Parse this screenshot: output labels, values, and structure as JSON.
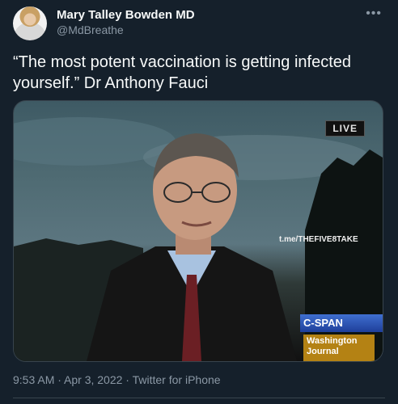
{
  "author": {
    "name": "Mary Talley Bowden MD",
    "handle": "@MdBreathe"
  },
  "tweet": {
    "text": "“The most potent vaccination is getting infected yourself.” Dr Anthony Fauci"
  },
  "media": {
    "live_label": "LIVE",
    "watermark": "t.me/THEFIVE8TAKE",
    "network_label": "C-SPAN",
    "program_label_line1": "Washington",
    "program_label_line2": "Journal"
  },
  "meta": {
    "timestamp": "9:53 AM · Apr 3, 2022 · Twitter for iPhone"
  },
  "icons": {
    "more": "more-options-icon"
  }
}
